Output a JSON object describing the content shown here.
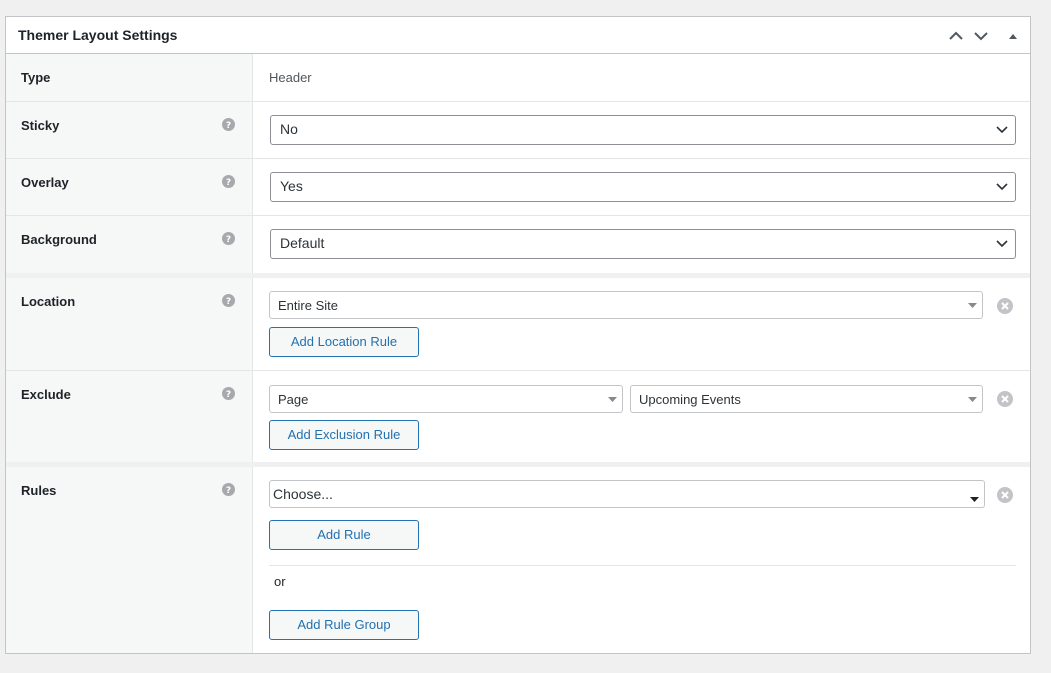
{
  "panel": {
    "title": "Themer Layout Settings"
  },
  "type": {
    "label": "Type",
    "value": "Header"
  },
  "sticky": {
    "label": "Sticky",
    "value": "No"
  },
  "overlay": {
    "label": "Overlay",
    "value": "Yes"
  },
  "background": {
    "label": "Background",
    "value": "Default"
  },
  "location": {
    "label": "Location",
    "value": "Entire Site",
    "add_label": "Add Location Rule"
  },
  "exclude": {
    "label": "Exclude",
    "value1": "Page",
    "value2": "Upcoming Events",
    "add_label": "Add Exclusion Rule"
  },
  "rules": {
    "label": "Rules",
    "value": "Choose...",
    "add_label": "Add Rule",
    "or_text": "or",
    "add_group_label": "Add Rule Group"
  },
  "icons": {
    "help": "help-icon",
    "remove": "remove-icon",
    "chevron": "chevron-down-icon"
  },
  "colors": {
    "accent": "#2271b1",
    "label_bg": "#f6f7f7",
    "border": "#c3c4c7",
    "icon_gray": "#a7aaad"
  }
}
